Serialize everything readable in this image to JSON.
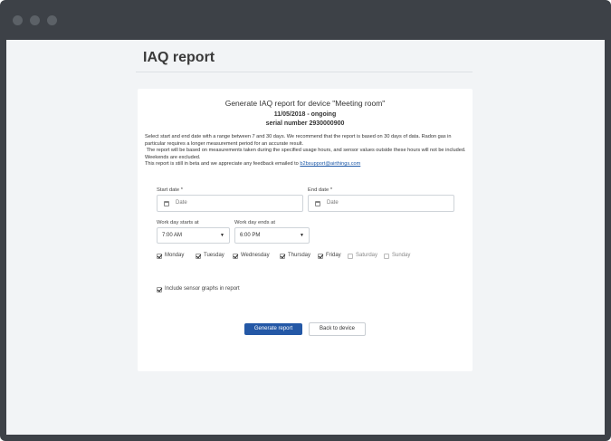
{
  "page": {
    "title": "IAQ report"
  },
  "card": {
    "title": "Generate IAQ report for device \"Meeting room\"",
    "date_range": "11/05/2018 - ongoing",
    "serial": "serial number 2930000900",
    "description": [
      "Select start and end date with a range between 7 and 30 days. We recommend that the report is based on 30 days of data. Radon gas in particular requires a longer measurement period for an accurate result.",
      "The report will be based on measurements taken during the specified usage hours, and sensor values outside these hours will not be included. Weekends are excluded.",
      "This report is still in beta and we appreciate any feedback emailed to"
    ],
    "feedback_email": "b2bsupport@airthings.com"
  },
  "form": {
    "start_date": {
      "label": "Start date *",
      "placeholder": "Date"
    },
    "end_date": {
      "label": "End date *",
      "placeholder": "Date"
    },
    "work_start": {
      "label": "Work day starts at",
      "value": "7:00 AM"
    },
    "work_end": {
      "label": "Work day ends at",
      "value": "6:00 PM"
    },
    "days": [
      {
        "label": "Monday",
        "checked": true
      },
      {
        "label": "Tuesday",
        "checked": true
      },
      {
        "label": "Wednesday",
        "checked": true
      },
      {
        "label": "Thursday",
        "checked": true
      },
      {
        "label": "Friday",
        "checked": true
      },
      {
        "label": "Saturday",
        "checked": false
      },
      {
        "label": "Sunday",
        "checked": false
      }
    ],
    "include_graphs": {
      "label": "Include sensor graphs in report",
      "checked": true
    }
  },
  "actions": {
    "generate": "Generate report",
    "back": "Back to device"
  },
  "colors": {
    "primary": "#2458a6",
    "frame": "#3d4147",
    "background": "#f2f4f6",
    "link": "#1f5aa8"
  }
}
